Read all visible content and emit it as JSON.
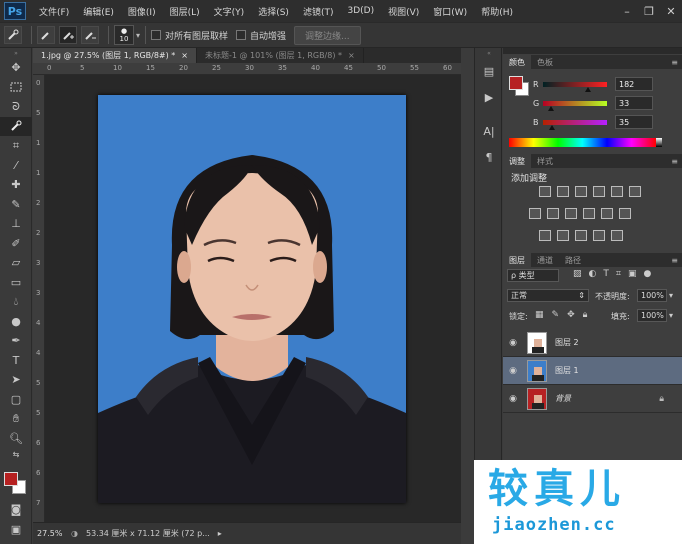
{
  "app": {
    "logo": "Ps"
  },
  "menu": [
    "文件(F)",
    "编辑(E)",
    "图像(I)",
    "图层(L)",
    "文字(Y)",
    "选择(S)",
    "滤镜(T)",
    "3D(D)",
    "视图(V)",
    "窗口(W)",
    "帮助(H)"
  ],
  "window_controls": {
    "minimize": "–",
    "restore": "❐",
    "close": "✕"
  },
  "options": {
    "brush_size": "10",
    "sample_all_layers": "对所有图层取样",
    "auto_enhance": "自动增强",
    "refine_edge": "调整边缘..."
  },
  "tabs": [
    {
      "label": "1.jpg @ 27.5% (图层 1, RGB/8#) *",
      "close": "×"
    },
    {
      "label": "未标题-1 @ 101% (图层 1, RGB/8) *",
      "close": "×"
    }
  ],
  "ruler_h": [
    "0",
    "5",
    "10",
    "15",
    "20",
    "25",
    "30",
    "35",
    "40",
    "45",
    "50",
    "55",
    "60"
  ],
  "ruler_v": [
    "0",
    "5",
    "1",
    "1",
    "2",
    "2",
    "3",
    "3",
    "4",
    "4",
    "5",
    "5",
    "6",
    "6",
    "7"
  ],
  "status": {
    "zoom": "27.5%",
    "doc_size": "53.34 厘米 x 71.12 厘米 (72 p..."
  },
  "color_panel": {
    "tabs": [
      "颜色",
      "色板"
    ],
    "channels": [
      {
        "letter": "R",
        "value": "182",
        "fraction": 0.71
      },
      {
        "letter": "G",
        "value": "33",
        "fraction": 0.13
      },
      {
        "letter": "B",
        "value": "35",
        "fraction": 0.14
      }
    ],
    "foreground": "#b62123",
    "background": "#ffffff"
  },
  "adjust_panel": {
    "tabs": [
      "调整",
      "样式"
    ],
    "title": "添加调整"
  },
  "layers_panel": {
    "tabs": [
      "图层",
      "通道",
      "路径"
    ],
    "filter": "ρ 类型",
    "blend_mode": "正常",
    "opacity_label": "不透明度:",
    "opacity": "100%",
    "lock_label": "锁定:",
    "fill_label": "填充:",
    "fill": "100%",
    "layers": [
      {
        "name": "图层 2",
        "selected": false,
        "locked": false
      },
      {
        "name": "图层 1",
        "selected": true,
        "locked": false
      },
      {
        "name": "背景",
        "selected": false,
        "locked": true
      }
    ]
  },
  "watermark": {
    "big": "较真儿",
    "small": "jiaozhen.cc"
  }
}
